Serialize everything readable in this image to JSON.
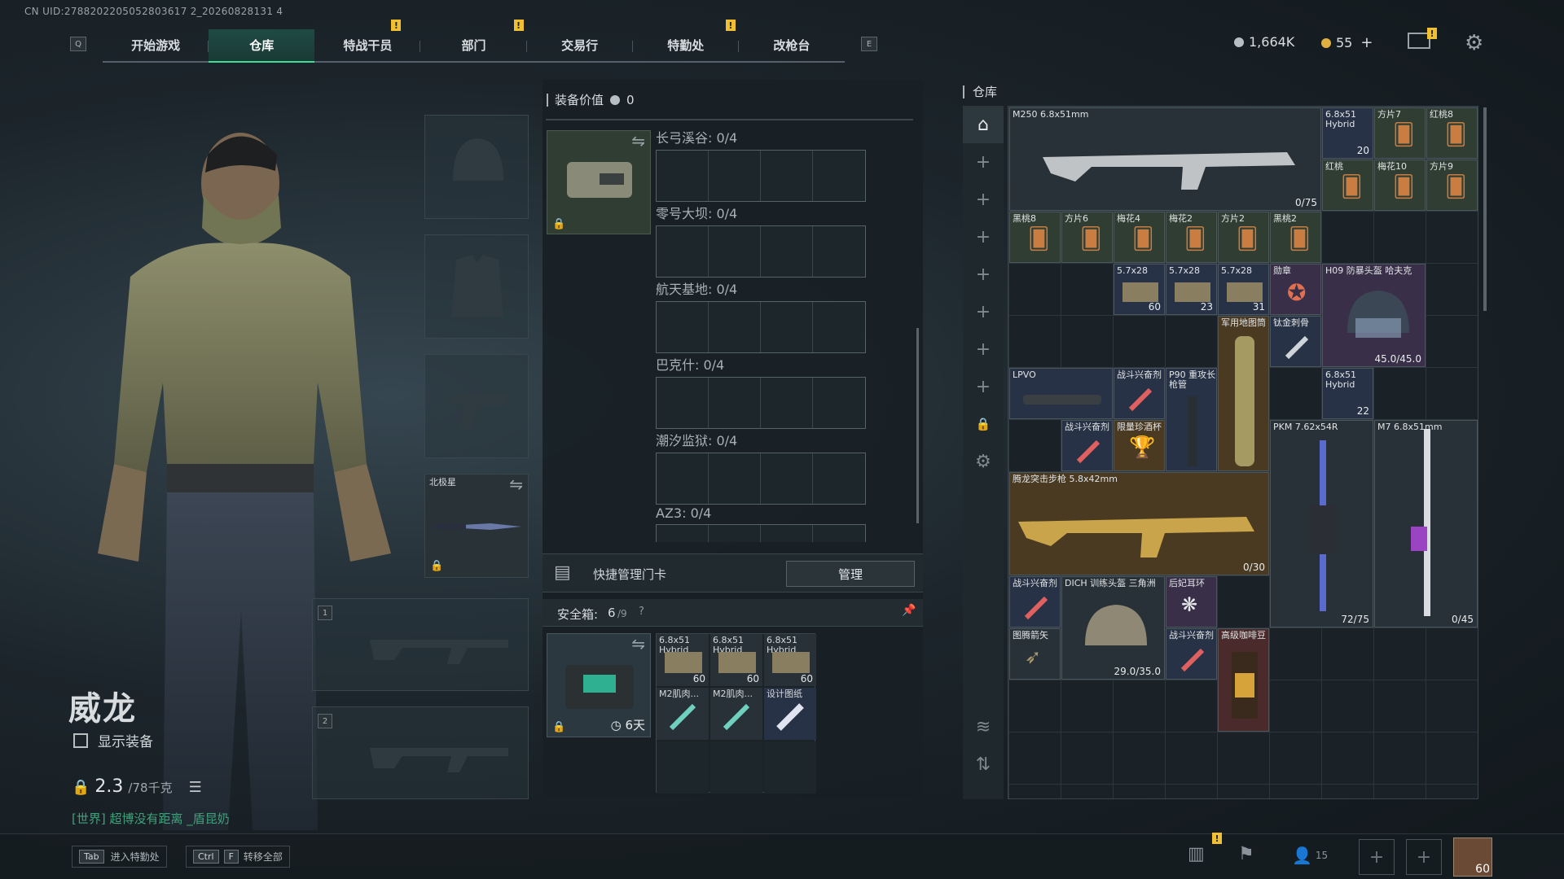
{
  "uid": "CN UID:2788202205052803617 2_20260828131 4",
  "nav": {
    "left_key": "Q",
    "right_key": "E",
    "tabs": [
      {
        "label": "开始游戏",
        "alert": false
      },
      {
        "label": "仓库",
        "alert": false,
        "active": true
      },
      {
        "label": "特战干员",
        "alert": true
      },
      {
        "label": "部门",
        "alert": true
      },
      {
        "label": "交易行",
        "alert": false
      },
      {
        "label": "特勤处",
        "alert": true
      },
      {
        "label": "改枪台",
        "alert": false
      }
    ],
    "alert_glyph": "!"
  },
  "currency": {
    "silver": "1,664K",
    "gold": "55",
    "plus": "+"
  },
  "character": {
    "name": "威龙",
    "show_gear_label": "显示装备",
    "weight_value": "2.3",
    "weight_max": "/78千克",
    "world_chat": "[世界] 超博没有距离 _盾昆奶"
  },
  "equip": {
    "melee_name": "北极星",
    "weapon_slot_1": "1",
    "weapon_slot_2": "2"
  },
  "mid": {
    "equip_value_label": "装备价值",
    "equip_value": "0",
    "keycard_maps": [
      {
        "label": "长弓溪谷: 0/4"
      },
      {
        "label": "零号大坝: 0/4"
      },
      {
        "label": "航天基地: 0/4"
      },
      {
        "label": "巴克什: 0/4"
      },
      {
        "label": "潮汐监狱: 0/4"
      },
      {
        "label": "AZ3: 0/4"
      }
    ],
    "quick_manage_label": "快捷管理门卡",
    "manage_button": "管理",
    "safe_box_label": "安全箱:",
    "safe_box_value": "6",
    "safe_box_max": "/9",
    "safe_box_days": "6天",
    "safe_items": [
      {
        "label": "6.8x51 Hybrid",
        "count": "60"
      },
      {
        "label": "6.8x51 Hybrid",
        "count": "60"
      },
      {
        "label": "6.8x51 Hybrid",
        "count": "60"
      },
      {
        "label": "M2肌肉...",
        "count": ""
      },
      {
        "label": "M2肌肉...",
        "count": ""
      },
      {
        "label": "设计图纸",
        "count": ""
      }
    ]
  },
  "warehouse": {
    "title": "仓库",
    "items": {
      "m250": {
        "label": "M250 6.8x51mm",
        "count": "0/75"
      },
      "ammo1": {
        "label": "6.8x51 Hybrid",
        "count": "20"
      },
      "c1": {
        "label": "方片7"
      },
      "c2": {
        "label": "红桃8"
      },
      "c3": {
        "label": "红桃"
      },
      "c4": {
        "label": "梅花10"
      },
      "c5": {
        "label": "方片9"
      },
      "c6": {
        "label": "黑桃8"
      },
      "c7": {
        "label": "方片6"
      },
      "c8": {
        "label": "梅花4"
      },
      "c9": {
        "label": "梅花2"
      },
      "c10": {
        "label": "方片2"
      },
      "c11": {
        "label": "黑桃2"
      },
      "a57_1": {
        "label": "5.7x28",
        "count": "60"
      },
      "a57_2": {
        "label": "5.7x28",
        "count": "23"
      },
      "a57_3": {
        "label": "5.7x28",
        "count": "31"
      },
      "medal": {
        "label": "勋章"
      },
      "helmet_h09": {
        "label": "H09 防暴头盔 哈夫克",
        "count": "45.0/45.0"
      },
      "map_tube": {
        "label": "军用地图筒"
      },
      "ti_tool": {
        "label": "钛金刺骨"
      },
      "lpvo": {
        "label": "LPVO"
      },
      "stim1": {
        "label": "战斗兴奋剂"
      },
      "p90": {
        "label": "P90 重攻长枪管"
      },
      "ammo2": {
        "label": "6.8x51 Hybrid",
        "count": "22"
      },
      "stim2": {
        "label": "战斗兴奋剂"
      },
      "cup": {
        "label": "限量珍酒杯"
      },
      "pkm": {
        "label": "PKM 7.62x54R",
        "count": "72/75"
      },
      "m7": {
        "label": "M7 6.8x51mm",
        "count": "0/45"
      },
      "tenglong": {
        "label": "腾龙突击步枪 5.8x42mm",
        "count": "0/30"
      },
      "stim3": {
        "label": "战斗兴奋剂"
      },
      "dich": {
        "label": "DICH 训练头盔 三角洲",
        "count": "29.0/35.0"
      },
      "earring": {
        "label": "后妃耳环"
      },
      "arrow": {
        "label": "图腾箭矢"
      },
      "stim4": {
        "label": "战斗兴奋剂"
      },
      "coffee": {
        "label": "高级咖啡豆"
      }
    }
  },
  "bottom": {
    "tab_key": "Tab",
    "tab_hint": "进入特勤处",
    "ctrl_key": "Ctrl",
    "f_key": "F",
    "transfer_hint": "转移全部",
    "friends_count": "15",
    "level": "60"
  }
}
